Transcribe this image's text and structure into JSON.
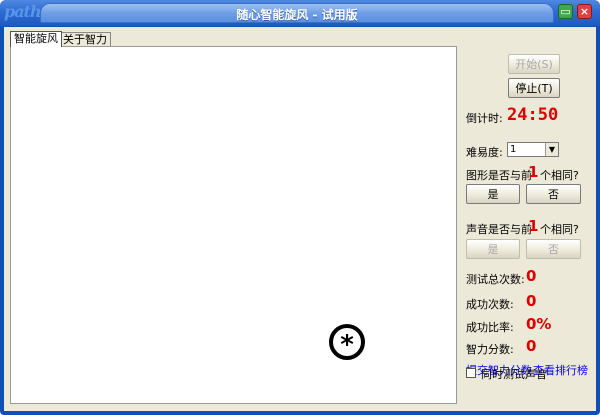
{
  "window": {
    "title": "随心智能旋风 - 试用版",
    "logo_text": "path",
    "minimize_icon": "printer-icon",
    "close_icon": "close-icon",
    "colors": {
      "titlebar": "#2d6bd3",
      "frame": "#0f4fb8",
      "accent_red": "#e00000",
      "link": "#0000ee"
    }
  },
  "tabs": [
    {
      "label": "智能旋风",
      "active": true
    },
    {
      "label": "关于智力",
      "active": false
    }
  ],
  "stage": {
    "shape_symbol": "*",
    "shape_icon": "circled-asterisk-icon"
  },
  "panel": {
    "start_label": "开始(S)",
    "stop_label": "停止(T)",
    "countdown_label": "倒计时:",
    "countdown_value": "24:50",
    "difficulty_label": "难易度:",
    "difficulty_value": "1",
    "shape_question_prefix": "图形是否与前",
    "shape_question_n": "1",
    "shape_question_suffix": "个相同?",
    "yes_label": "是",
    "no_label": "否",
    "sound_question_prefix": "声音是否与前",
    "sound_question_n": "1",
    "sound_question_suffix": "个相同?",
    "sound_yes_label": "是",
    "sound_no_label": "否",
    "total_tests_label": "测试总次数:",
    "total_tests_value": "0",
    "success_count_label": "成功次数:",
    "success_count_value": "0",
    "success_rate_label": "成功比率:",
    "success_rate_value": "0%",
    "iq_score_label": "智力分数:",
    "iq_score_value": "0",
    "submit_link": "提交智力分数",
    "ranking_link": "查看排行榜",
    "sound_test_checkbox_label": "同时测试声音",
    "sound_test_checked": false
  }
}
